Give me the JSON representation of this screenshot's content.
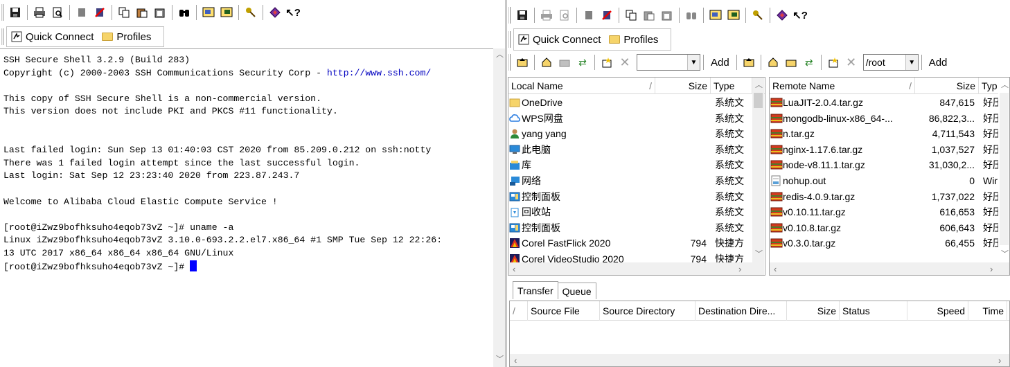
{
  "left": {
    "quick_connect": "Quick Connect",
    "profiles": "Profiles",
    "terminal_lines": [
      "SSH Secure Shell 3.2.9 (Build 283)",
      "Copyright (c) 2000-2003 SSH Communications Security Corp - ",
      "",
      "This copy of SSH Secure Shell is a non-commercial version.",
      "This version does not include PKI and PKCS #11 functionality.",
      "",
      "",
      "Last failed login: Sun Sep 13 01:40:03 CST 2020 from 85.209.0.212 on ssh:notty",
      "There was 1 failed login attempt since the last successful login.",
      "Last login: Sat Sep 12 23:23:40 2020 from 223.87.243.7",
      "",
      "Welcome to Alibaba Cloud Elastic Compute Service !",
      "",
      "[root@iZwz9bofhksuho4eqob73vZ ~]# uname -a",
      "Linux iZwz9bofhksuho4eqob73vZ 3.10.0-693.2.2.el7.x86_64 #1 SMP Tue Sep 12 22:26:",
      "13 UTC 2017 x86_64 x86_64 x86_64 GNU/Linux",
      "[root@iZwz9bofhksuho4eqob73vZ ~]# "
    ],
    "copyright_url": "http://www.ssh.com/"
  },
  "right": {
    "quick_connect": "Quick Connect",
    "profiles": "Profiles",
    "local_path": "",
    "remote_path": "/root",
    "add_label": "Add",
    "local_headers": {
      "name": "Local Name",
      "sort": "/",
      "size": "Size",
      "type": "Type"
    },
    "local_files": [
      {
        "name": "OneDrive",
        "size": "",
        "type": "系统文",
        "icon": "folder-icon"
      },
      {
        "name": "WPS网盘",
        "size": "",
        "type": "系统文",
        "icon": "cloud-icon"
      },
      {
        "name": "yang yang",
        "size": "",
        "type": "系统文",
        "icon": "user-icon"
      },
      {
        "name": "此电脑",
        "size": "",
        "type": "系统文",
        "icon": "computer-icon"
      },
      {
        "name": "库",
        "size": "",
        "type": "系统文",
        "icon": "library-icon"
      },
      {
        "name": "网络",
        "size": "",
        "type": "系统文",
        "icon": "network-icon"
      },
      {
        "name": "控制面板",
        "size": "",
        "type": "系统文",
        "icon": "control-panel-icon"
      },
      {
        "name": "回收站",
        "size": "",
        "type": "系统文",
        "icon": "recycle-bin-icon"
      },
      {
        "name": "控制面板",
        "size": "",
        "type": "系统文",
        "icon": "control-panel-icon"
      },
      {
        "name": "Corel FastFlick 2020",
        "size": "794",
        "type": "快捷方",
        "icon": "app-icon"
      },
      {
        "name": "Corel VideoStudio 2020",
        "size": "794",
        "type": "快捷方",
        "icon": "app-icon"
      }
    ],
    "remote_headers": {
      "name": "Remote Name",
      "sort": "/",
      "size": "Size",
      "type": "Typ"
    },
    "remote_files": [
      {
        "name": "LuaJIT-2.0.4.tar.gz",
        "size": "847,615",
        "type": "好压",
        "icon": "archive-icon"
      },
      {
        "name": "mongodb-linux-x86_64-...",
        "size": "86,822,3...",
        "type": "好压",
        "icon": "archive-icon"
      },
      {
        "name": "n.tar.gz",
        "size": "4,711,543",
        "type": "好压",
        "icon": "archive-icon"
      },
      {
        "name": "nginx-1.17.6.tar.gz",
        "size": "1,037,527",
        "type": "好压",
        "icon": "archive-icon"
      },
      {
        "name": "node-v8.11.1.tar.gz",
        "size": "31,030,2...",
        "type": "好压",
        "icon": "archive-icon"
      },
      {
        "name": "nohup.out",
        "size": "0",
        "type": "Wir",
        "icon": "text-file-icon"
      },
      {
        "name": "redis-4.0.9.tar.gz",
        "size": "1,737,022",
        "type": "好压",
        "icon": "archive-icon"
      },
      {
        "name": "v0.10.11.tar.gz",
        "size": "616,653",
        "type": "好压",
        "icon": "archive-icon"
      },
      {
        "name": "v0.10.8.tar.gz",
        "size": "606,643",
        "type": "好压",
        "icon": "archive-icon"
      },
      {
        "name": "v0.3.0.tar.gz",
        "size": "66,455",
        "type": "好压",
        "icon": "archive-icon"
      }
    ],
    "tabs": {
      "transfer": "Transfer",
      "queue": "Queue"
    },
    "transfer_headers": {
      "sort": "/",
      "source_file": "Source File",
      "source_dir": "Source Directory",
      "dest_dir": "Destination Dire...",
      "size": "Size",
      "status": "Status",
      "speed": "Speed",
      "time": "Time"
    }
  },
  "colors": {
    "cursor": "#0000ff",
    "url": "#0000c0",
    "folder": "#f6d46a",
    "archive": "#d23a1e"
  }
}
